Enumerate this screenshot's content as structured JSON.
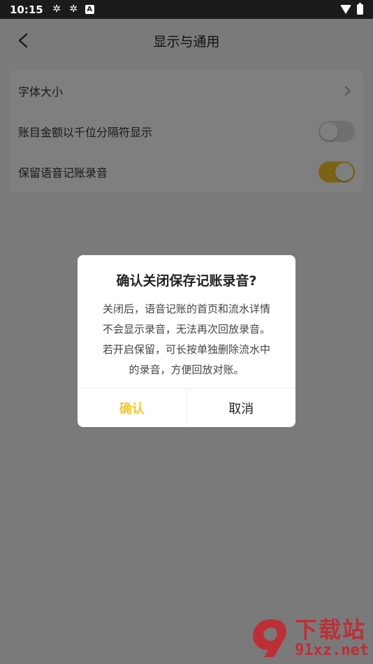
{
  "status_bar": {
    "time": "10:15",
    "icons": [
      "app-notification-icon",
      "app-notification-icon",
      "a-icon",
      "wifi-icon",
      "battery-charging-icon"
    ]
  },
  "header": {
    "title": "显示与通用"
  },
  "settings": {
    "rows": [
      {
        "label": "字体大小",
        "type": "chevron"
      },
      {
        "label": "账目金额以千位分隔符显示",
        "type": "switch",
        "on": false
      },
      {
        "label": "保留语音记账录音",
        "type": "switch",
        "on": true
      }
    ]
  },
  "dialog": {
    "title": "确认关闭保存记账录音?",
    "body_lines": [
      "关闭后，语音记账的首页和流水详情",
      "不会显示录音，无法再次回放录音。",
      "若开启保留，可长按单独删除流水中",
      "的录音，方便回放对账。"
    ],
    "confirm_label": "确认",
    "cancel_label": "取消"
  },
  "watermark": {
    "cn": "下载站",
    "url": "91xz.net"
  },
  "colors": {
    "accent": "#f4c62a",
    "watermark": "#c9232b"
  }
}
